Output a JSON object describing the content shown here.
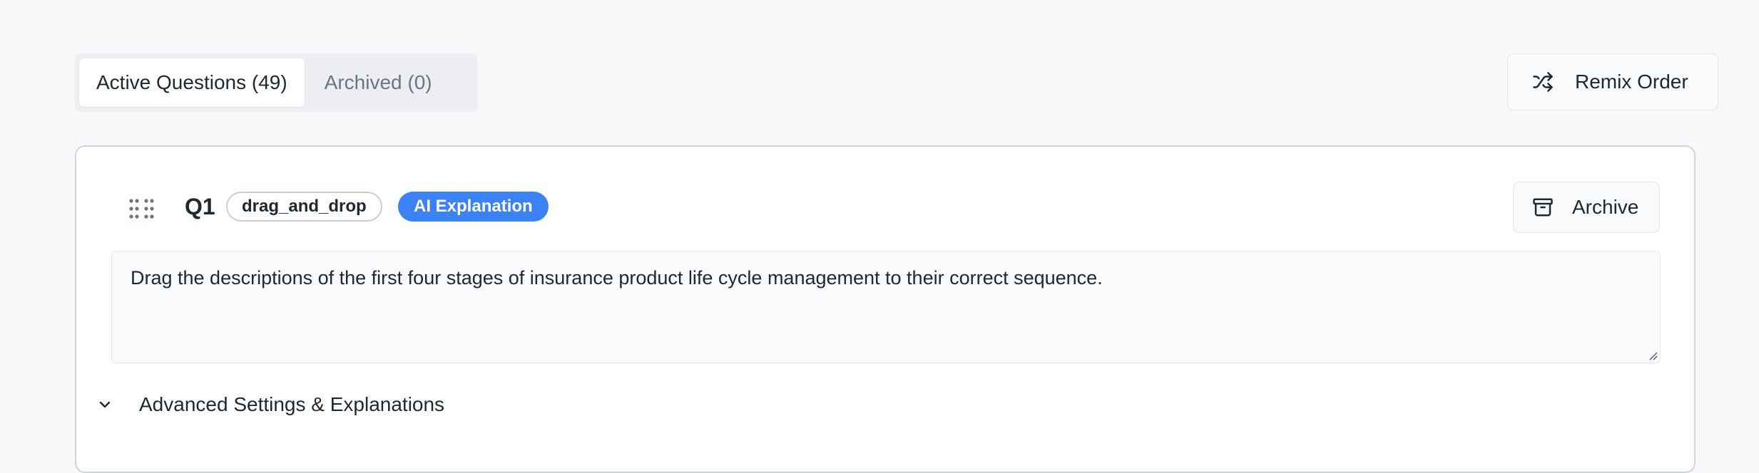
{
  "tabs": [
    {
      "label": "Active Questions (49)",
      "active": true
    },
    {
      "label": "Archived (0)",
      "active": false
    }
  ],
  "toolbar": {
    "remix_label": "Remix Order",
    "remix_icon": "shuffle-icon"
  },
  "question": {
    "number": "Q1",
    "type_badge": "drag_and_drop",
    "ai_badge": "AI Explanation",
    "archive_label": "Archive",
    "archive_icon": "archive-icon",
    "text": "Drag the descriptions of the first four stages of insurance product life cycle management to their correct sequence.",
    "advanced_label": "Advanced Settings & Explanations",
    "advanced_icon": "chevron-down-icon"
  },
  "colors": {
    "accent": "#3b82f6",
    "page_bg": "#f7f8fa",
    "card_border": "#cfd6df"
  }
}
